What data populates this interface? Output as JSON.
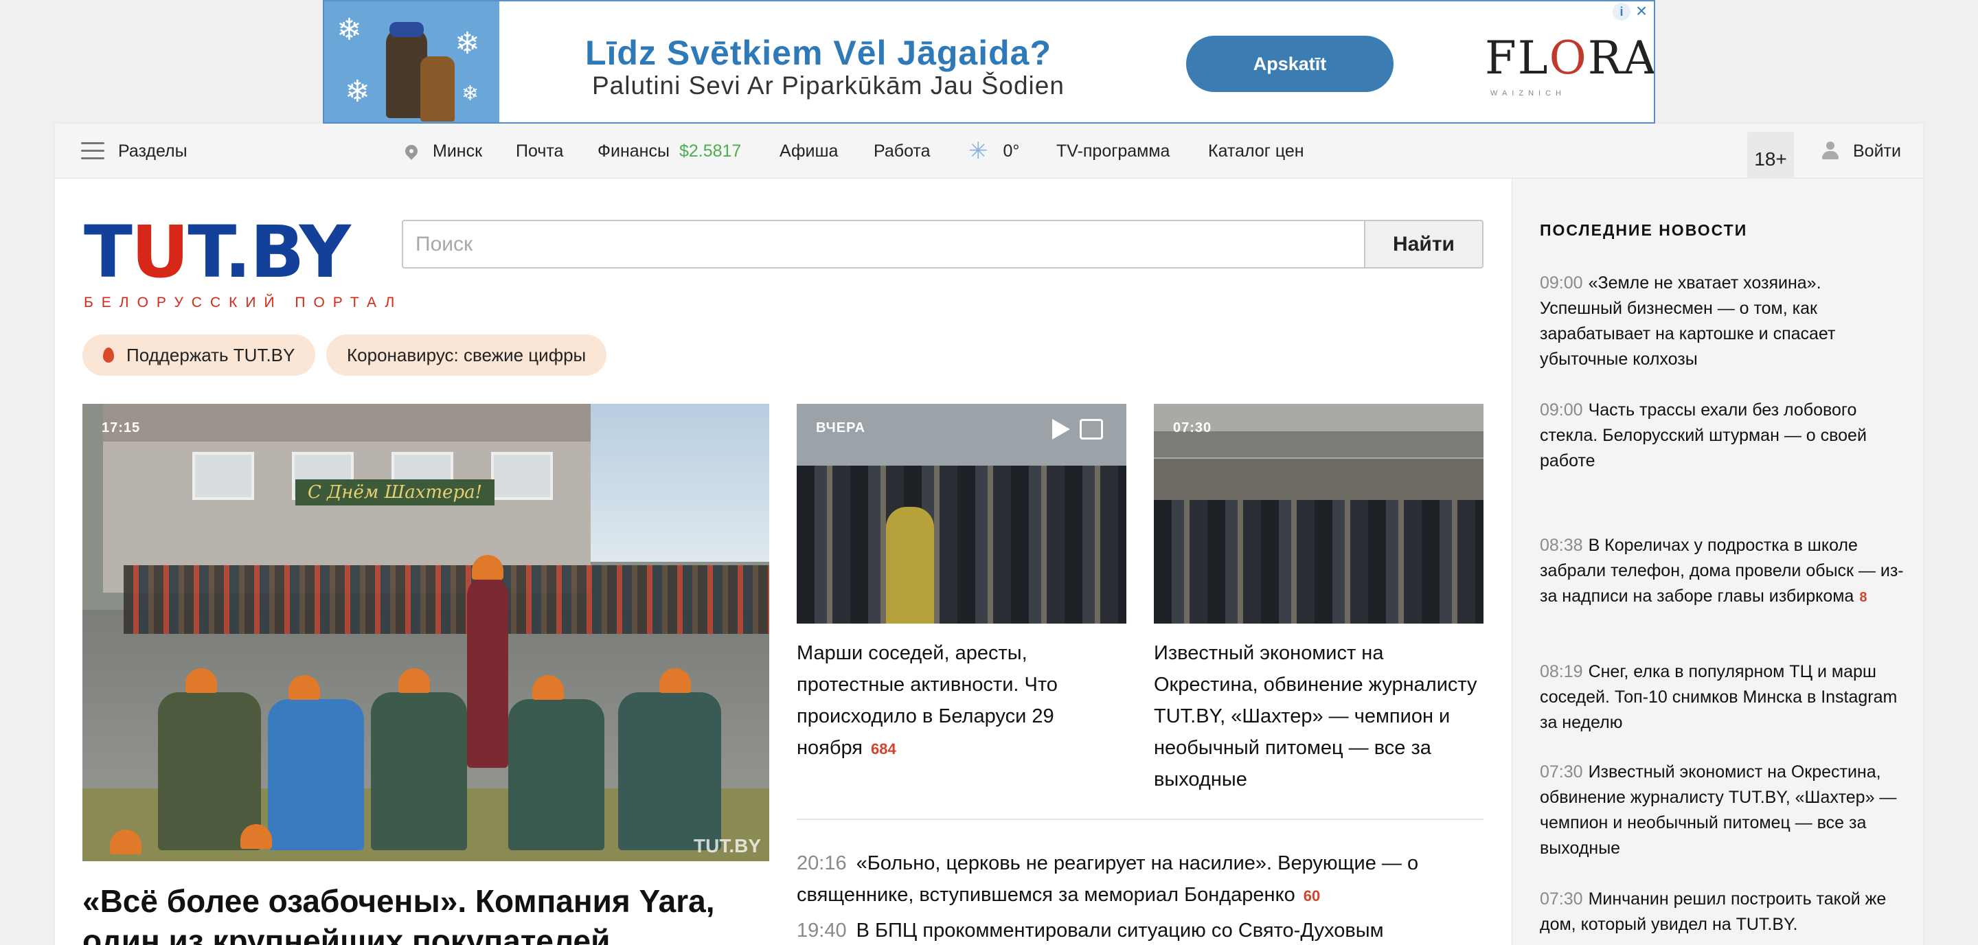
{
  "ad": {
    "title": "Līdz Svētkiem Vēl Jāgaida?",
    "subtitle": "Palutini Sevi Ar Piparkūkām Jau Šodien",
    "button": "Apskatīt",
    "logo": "FLORA",
    "logo_sub": "WAIZNICH",
    "info_icon": "i",
    "close_icon": "×"
  },
  "nav": {
    "sections": "Разделы",
    "city": "Минск",
    "mail": "Почта",
    "finance": "Финансы",
    "finance_rate": "$2.5817",
    "afisha": "Афиша",
    "work": "Работа",
    "weather": "0°",
    "tv": "TV-программа",
    "catalog": "Каталог цен",
    "age": "18+",
    "login": "Войти"
  },
  "logo": {
    "text_a": "T",
    "text_u": "U",
    "text_b": "T.BY",
    "subtitle": "БЕЛОРУССКИЙ ПОРТАЛ"
  },
  "search": {
    "placeholder": "Поиск",
    "button": "Найти"
  },
  "pills": {
    "support": "Поддержать TUT.BY",
    "covid": "Коронавирус: свежие цифры"
  },
  "main_story": {
    "time": "17:15",
    "sign": "С Днём Шахтера!",
    "watermark": "TUT.BY",
    "title": "«Всё более озабочены». Компания Yara, один из крупнейших покупателей"
  },
  "cards": [
    {
      "time": "ВЧЕРА",
      "title": "Марши соседей, аресты, протестные активности. Что происходило в Беларуси 29 ноября",
      "count": "684"
    },
    {
      "time": "07:30",
      "title": "Известный экономист на Окрестина, обвинение журналисту TUT.BY, «Шахтер» — чемпион и необычный питомец — все за выходные",
      "count": ""
    }
  ],
  "feed": [
    {
      "time": "20:16",
      "title": "«Больно, церковь не реагирует на насилие». Верующие — о священнике, вступившемся за мемориал Бондаренко",
      "count": "60"
    },
    {
      "time": "19:40",
      "title": "В БПЦ прокомментировали ситуацию со Свято-Духовым собором",
      "count": ""
    }
  ],
  "sidebar": {
    "heading": "ПОСЛЕДНИЕ НОВОСТИ",
    "items": [
      {
        "time": "09:00",
        "title": "«Земле не хватает хозяина». Успешный бизнесмен — о том, как зарабатывает на картошке и спасает убыточные колхозы",
        "count": ""
      },
      {
        "time": "09:00",
        "title": "Часть трассы ехали без лобового стекла. Белорусский штурман — о своей работе",
        "count": ""
      },
      {
        "time": "08:38",
        "title": "В Кореличах у подростка в школе забрали телефон, дома провели обыск — из-за надписи на заборе главы избиркома",
        "count": "8"
      },
      {
        "time": "08:19",
        "title": "Снег, елка в популярном ТЦ и марш соседей. Топ-10 снимков Минска в Instagram за неделю",
        "count": ""
      },
      {
        "time": "07:30",
        "title": "Известный экономист на Окрестина, обвинение журналисту TUT.BY, «Шахтер» — чемпион и необычный питомец — все за выходные",
        "count": ""
      },
      {
        "time": "07:30",
        "title": "Минчанин решил построить такой же дом, который увидел на TUT.BY.",
        "count": ""
      }
    ]
  },
  "colors": {
    "brand_blue": "#13419a",
    "brand_red": "#d62718",
    "rate_green": "#4caf50",
    "counter_red": "#d2432c",
    "pill_bg": "#fbe6d6"
  }
}
